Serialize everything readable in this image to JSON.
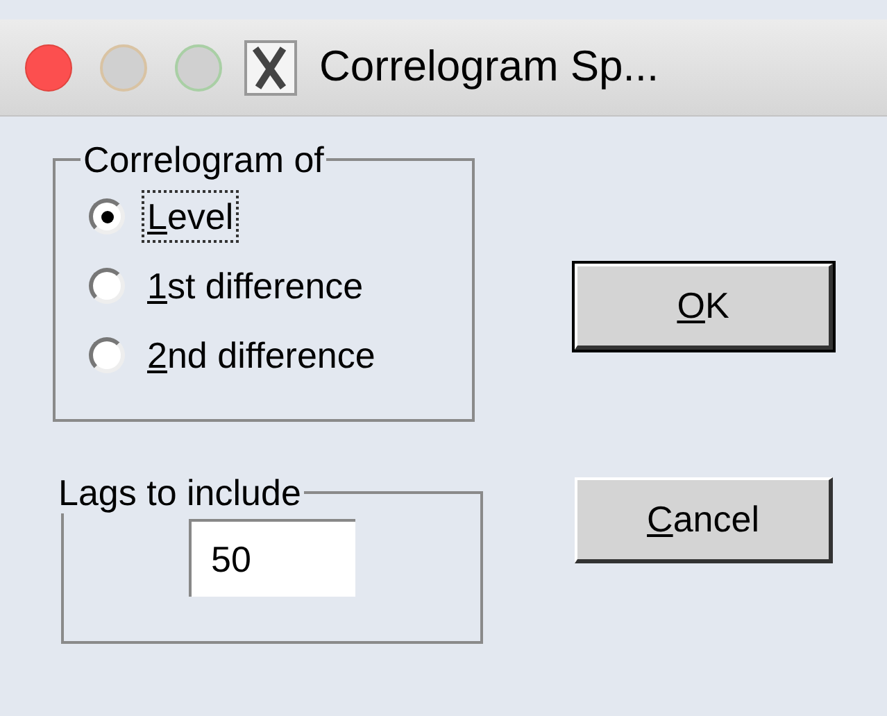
{
  "window": {
    "title": "Correlogram Sp..."
  },
  "correlogram_of": {
    "label": "Correlogram of",
    "options": [
      {
        "label": "Level",
        "selected": true
      },
      {
        "label": "1st difference",
        "selected": false
      },
      {
        "label": "2nd difference",
        "selected": false
      }
    ]
  },
  "lags": {
    "label": "Lags to include",
    "value": "50"
  },
  "buttons": [
    {
      "label": "OK"
    },
    {
      "label": "Cancel"
    }
  ]
}
